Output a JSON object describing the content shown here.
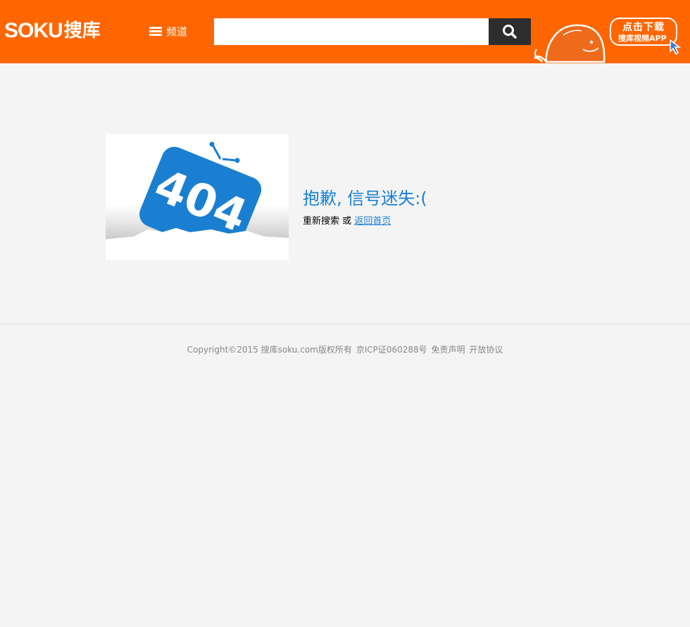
{
  "header": {
    "logo_en": "SOKU",
    "logo_cn": "搜库",
    "channel_label": "频道",
    "search": {
      "value": "",
      "placeholder": ""
    },
    "app_badge": {
      "line1": "点击下载",
      "line2": "搜库视频APP"
    }
  },
  "error": {
    "image_text": "404",
    "title": "抱歉, 信号迷失:(",
    "research_text": "重新搜索",
    "or_text": "或",
    "home_link": "返回首页"
  },
  "footer": {
    "copyright": "Copyright©2015 搜库soku.com版权所有",
    "icp": "京ICP证060288号",
    "disclaimer": "免责声明",
    "open_protocol": "开放协议"
  },
  "colors": {
    "brand_orange": "#ff6600",
    "link_blue": "#1a7fd1",
    "search_button": "#2d2d2d"
  }
}
